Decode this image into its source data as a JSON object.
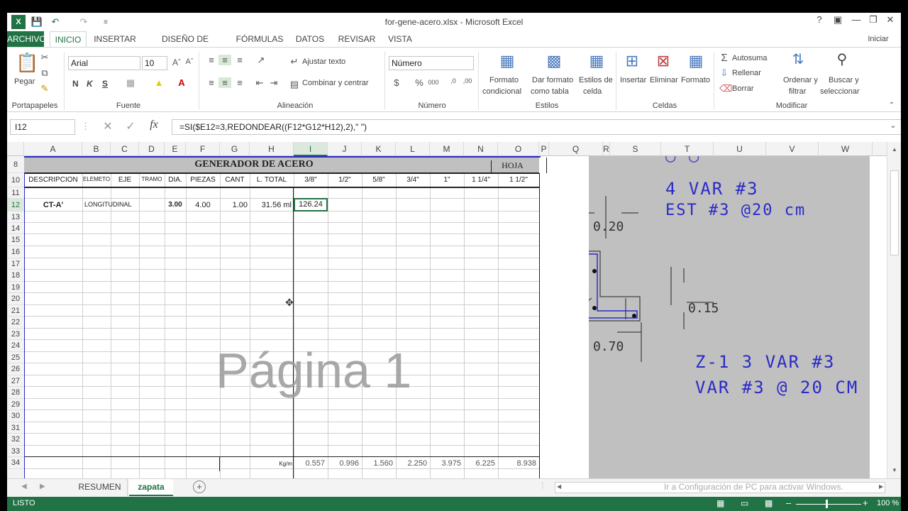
{
  "window": {
    "title": "for-gene-acero.xlsx - Microsoft Excel",
    "help": "?",
    "signin": "Iniciar sesión"
  },
  "tabs": [
    "ARCHIVO",
    "INICIO",
    "INSERTAR",
    "DISEÑO DE PÁGINA",
    "FÓRMULAS",
    "DATOS",
    "REVISAR",
    "VISTA"
  ],
  "ribbon": {
    "clipboard": {
      "paste": "Pegar",
      "group": "Portapapeles"
    },
    "font": {
      "name": "Arial",
      "size": "10",
      "bold": "N",
      "italic": "K",
      "underline": "S",
      "group": "Fuente"
    },
    "alignment": {
      "wrap": "Ajustar texto",
      "merge": "Combinar y centrar",
      "group": "Alineación"
    },
    "number": {
      "format": "Número",
      "group": "Número"
    },
    "styles": {
      "conditional": [
        "Formato",
        "condicional"
      ],
      "table": [
        "Dar formato",
        "como tabla"
      ],
      "cell": [
        "Estilos de",
        "celda"
      ],
      "group": "Estilos"
    },
    "cells": {
      "insert": "Insertar",
      "delete": "Eliminar",
      "format": "Formato",
      "group": "Celdas"
    },
    "editing": {
      "autosum": "Autosuma",
      "fill": "Rellenar",
      "clear": "Borrar",
      "sort": [
        "Ordenar y",
        "filtrar"
      ],
      "find": [
        "Buscar y",
        "seleccionar"
      ],
      "group": "Modificar"
    }
  },
  "formula_bar": {
    "name_box": "I12",
    "formula": "=SI($E12=3,REDONDEAR((F12*G12*H12),2),\" \")"
  },
  "columns": [
    "A",
    "B",
    "C",
    "D",
    "E",
    "F",
    "G",
    "H",
    "I",
    "J",
    "K",
    "L",
    "M",
    "N",
    "O",
    "P",
    "Q",
    "R",
    "S",
    "T",
    "U",
    "V",
    "W"
  ],
  "rows": [
    "8",
    "10",
    "11",
    "12",
    "13",
    "14",
    "15",
    "16",
    "17",
    "18",
    "19",
    "20",
    "21",
    "22",
    "23",
    "24",
    "25",
    "26",
    "27",
    "28",
    "29",
    "30",
    "31",
    "32",
    "33",
    "34"
  ],
  "sheet": {
    "title": "GENERADOR DE ACERO",
    "hoja": "HOJA",
    "headers": [
      "DESCRIPCION",
      "ELEMETO",
      "EJE",
      "TRAMO",
      "DIA.",
      "PIEZAS",
      "CANT",
      "L. TOTAL",
      "3/8\"",
      "1/2\"",
      "5/8\"",
      "3/4\"",
      "1\"",
      "1 1/4\"",
      "1 1/2\""
    ],
    "row12": {
      "desc": "CT-A'",
      "elem": "LONGITUDINAL",
      "dia": "3.00",
      "piezas": "4.00",
      "cant": "1.00",
      "ltotal": "31.56 ml",
      "i": "126.24"
    },
    "row34": {
      "label": "Kg/m",
      "values": [
        "0.557",
        "0.996",
        "1.560",
        "2.250",
        "3.975",
        "6.225",
        "8.938"
      ]
    },
    "watermark": "Página 1"
  },
  "cad": {
    "line1": "4 VAR #3",
    "line2": "EST #3 @20 cm",
    "dim1": "0.20",
    "dim2": "0.15",
    "dim3": "0.70",
    "line3": "Z-1  3  VAR #3",
    "line4": "VAR #3 @ 20 CM"
  },
  "sheet_tabs": [
    "RESUMEN",
    "zapata"
  ],
  "activate": "Ir a Configuración de PC para activar Windows.",
  "status": {
    "left": "LISTO",
    "zoom": "100 %"
  }
}
